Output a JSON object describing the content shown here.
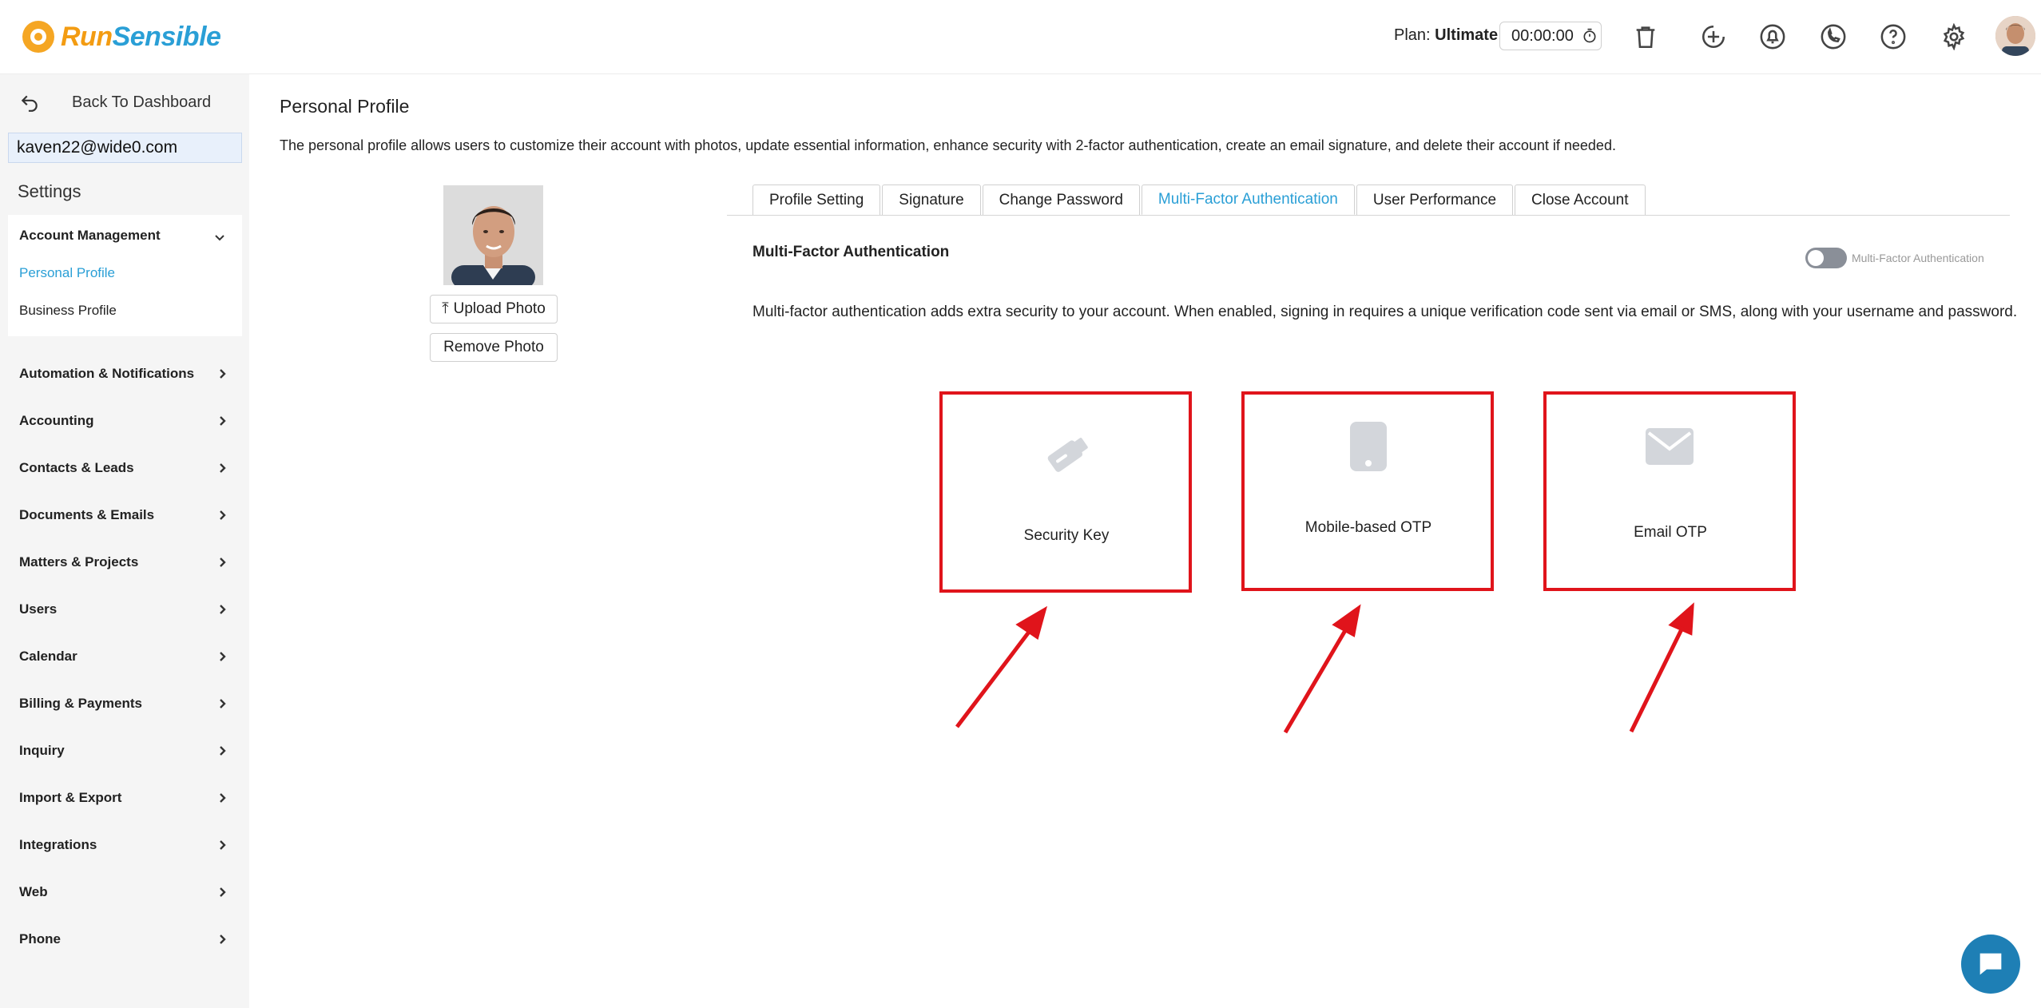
{
  "header": {
    "logo_run": "Run",
    "logo_sensible": "Sensible",
    "plan_label": "Plan:",
    "plan_value": "Ultimate",
    "timer": "00:00:00",
    "icons": [
      "trash-icon",
      "add-time-icon",
      "bell-icon",
      "phone-icon",
      "help-icon",
      "gear-icon"
    ]
  },
  "sidebar": {
    "back_label": "Back To Dashboard",
    "email": "kaven22@wide0.com",
    "settings_label": "Settings",
    "account_management": {
      "title": "Account Management",
      "items": [
        "Personal Profile",
        "Business Profile"
      ],
      "active": "Personal Profile"
    },
    "nav_items": [
      "Automation & Notifications",
      "Accounting",
      "Contacts & Leads",
      "Documents & Emails",
      "Matters & Projects",
      "Users",
      "Calendar",
      "Billing & Payments",
      "Inquiry",
      "Import & Export",
      "Integrations",
      "Web",
      "Phone"
    ]
  },
  "main": {
    "title": "Personal Profile",
    "description": "The personal profile allows users to customize their account with photos, update essential information, enhance security with 2-factor authentication, create an email signature, and delete their account if needed.",
    "upload_photo": "Upload Photo",
    "remove_photo": "Remove Photo",
    "tabs": [
      "Profile Setting",
      "Signature",
      "Change Password",
      "Multi-Factor Authentication",
      "User Performance",
      "Close Account"
    ],
    "active_tab": "Multi-Factor Authentication",
    "mfa": {
      "heading": "Multi-Factor Authentication",
      "toggle_label": "Multi-Factor Authentication",
      "toggle_on": false,
      "description": "Multi-factor authentication adds extra security to your account. When enabled, signing in requires a unique verification code sent via email or SMS, along with your username and password.",
      "options": [
        {
          "label": "Security Key",
          "icon": "usb-key-icon"
        },
        {
          "label": "Mobile-based OTP",
          "icon": "mobile-phone-icon"
        },
        {
          "label": "Email OTP",
          "icon": "envelope-icon"
        }
      ]
    }
  },
  "colors": {
    "accent": "#2a9fd6",
    "logo_orange": "#f39c12",
    "highlight_red": "#e0141b",
    "chat_button": "#1e7fb5"
  }
}
